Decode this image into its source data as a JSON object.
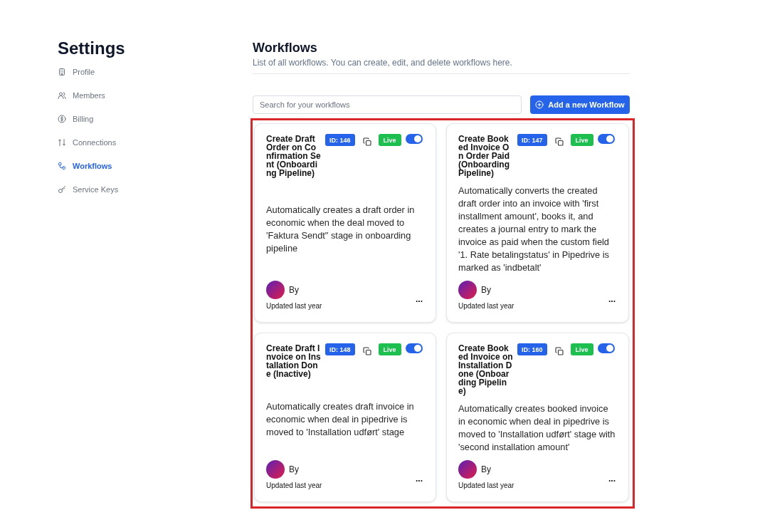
{
  "sidebar": {
    "title": "Settings",
    "items": [
      {
        "label": "Profile",
        "selected": false
      },
      {
        "label": "Members",
        "selected": false
      },
      {
        "label": "Billing",
        "selected": false
      },
      {
        "label": "Connections",
        "selected": false
      },
      {
        "label": "Workflows",
        "selected": true
      },
      {
        "label": "Service Keys",
        "selected": false
      }
    ]
  },
  "header": {
    "title": "Workflows",
    "subtitle": "List of all workflows. You can create, edit, and delete workflows here."
  },
  "search": {
    "placeholder": "Search for your workflows"
  },
  "add_button": {
    "label": "Add a new Workflow"
  },
  "workflows": {
    "highlighted": true,
    "cards": [
      {
        "title": "Create Draft Order on Confirmation Sent (Onboarding Pipeline)",
        "id_badge": "ID: 146",
        "status": "Live",
        "enabled": true,
        "description": "Automatically creates a draft order in economic when the deal moved to 'Faktura Sendt\" stage in onboarding pipeline",
        "author": "By",
        "updated": "Updated last year",
        "menu": "..."
      },
      {
        "title": "Create Booked Invoice On Order Paid (Onboarding Pipeline)",
        "id_badge": "ID: 147",
        "status": "Live",
        "enabled": true,
        "description": "Automatically converts the created draft order into an invoice with 'first installment amount', books it, and creates a journal entry to mark the invoice as paid when the custom field '1. Rate betalingstatus' in Pipedrive is marked as 'indbetalt'",
        "author": "By",
        "updated": "Updated last year",
        "menu": "..."
      },
      {
        "title": "Create Draft Invoice on Installation Done (Inactive)",
        "id_badge": "ID: 148",
        "status": "Live",
        "enabled": true,
        "description": "Automatically creates draft invoice in economic when deal in pipedrive is moved to 'Installation udført' stage",
        "author": "By",
        "updated": "Updated last year",
        "menu": "..."
      },
      {
        "title": "Create Booked Invoice on Installation Done (Onboarding Pipeline)",
        "id_badge": "ID: 160",
        "status": "Live",
        "enabled": true,
        "description": "Automatically creates booked invoice in economic when deal in pipedrive is moved to 'Installation udført' stage with 'second installation amount'",
        "author": "By",
        "updated": "Updated last year",
        "menu": "..."
      }
    ]
  }
}
